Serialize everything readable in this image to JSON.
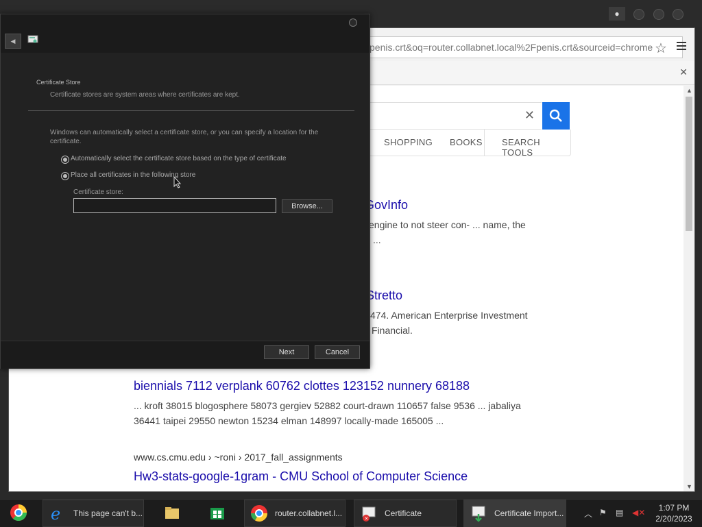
{
  "browser": {
    "address": "penis.crt&oq=router.collabnet.local%2Fpenis.crt&sourceid=chrome",
    "tabs": [
      "SHOPPING",
      "BOOKS",
      "SEARCH TOOLS"
    ],
    "results": [
      {
        "title": "GovInfo",
        "snippet1": "engine to not steer con- ... name, the",
        "snippet2": "..."
      },
      {
        "title": "Stretto",
        "snippet1": "474. American Enterprise Investment",
        "snippet2": "Financial."
      },
      {
        "url_partial": "www.cs.cmu.edu › ~roni › 2017_fall_assignments"
      },
      {
        "title": "biennials 7112 verplank 60762 clottes 123152 nunnery 68188",
        "snippet1": "... kroft 38015 blogosphere 58073 gergiev 52882 court-drawn 110657 false 9536 ... jabaliya",
        "snippet2": "36441 taipei 29550 newton 15234 elman 148997 locally-made 165005 ..."
      },
      {
        "url": "www.cs.cmu.edu › ~roni › 2017_fall_assignments",
        "title": "Hw3-stats-google-1gram - CMU School of Computer Science"
      }
    ]
  },
  "dialog": {
    "header_title": "Certificate Store",
    "header_subtitle": "Certificate stores are system areas where certificates are kept.",
    "intro": "Windows can automatically select a certificate store, or you can specify a location for the certificate.",
    "option_auto": "Automatically select the certificate store based on the type of certificate",
    "option_manual": "Place all certificates in the following store",
    "store_label": "Certificate store:",
    "store_value": "",
    "browse_label": "Browse...",
    "next_label": "Next",
    "cancel_label": "Cancel"
  },
  "taskbar": {
    "items": [
      {
        "label": "This page can't b..."
      },
      {
        "label": "router.collabnet.l..."
      },
      {
        "label": "Certificate"
      },
      {
        "label": "Certificate Import..."
      }
    ],
    "time": "1:07 PM",
    "date": "2/20/2023"
  }
}
